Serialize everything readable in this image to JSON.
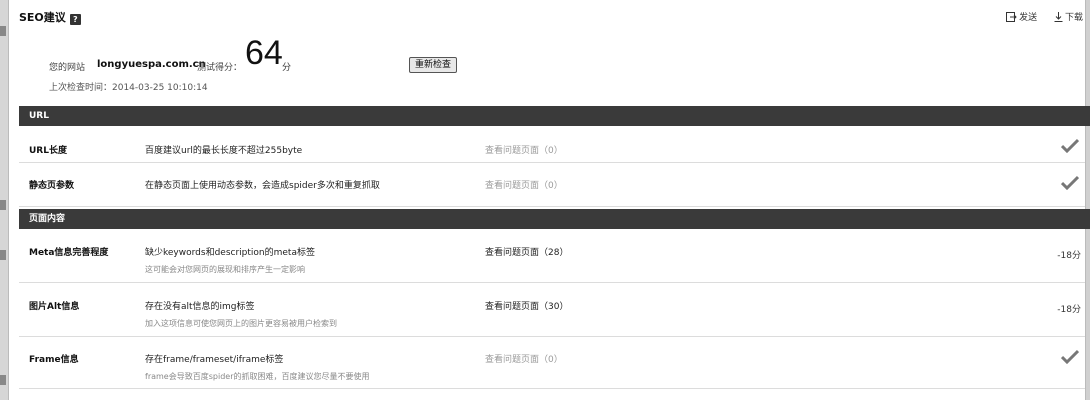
{
  "header": {
    "title": "SEO建议",
    "help_glyph": "?",
    "send_label": "发送",
    "download_label": "下载"
  },
  "summary": {
    "site_label": "您的网站",
    "site_value": "longyuespa.com.cn",
    "score_label": "测试得分：",
    "score_value": "64",
    "score_unit": "分",
    "recheck_label": "重新检查",
    "last_check": "上次检查时间：2014-03-25 10:10:14"
  },
  "sections": [
    {
      "title": "URL"
    },
    {
      "title": "页面内容"
    }
  ],
  "url_rows": [
    {
      "name": "URL长度",
      "desc": "百度建议url的最长长度不超过255byte",
      "link": "查看问题页面（0）",
      "status": "pass"
    },
    {
      "name": "静态页参数",
      "desc": "在静态页面上使用动态参数，会造成spider多次和重复抓取",
      "link": "查看问题页面（0）",
      "status": "pass"
    }
  ],
  "content_rows": [
    {
      "name": "Meta信息完善程度",
      "desc": "缺少keywords和description的meta标签",
      "note": "这可能会对您网页的展现和排序产生一定影响",
      "link": "查看问题页面（28）",
      "result": "-18分"
    },
    {
      "name": "图片Alt信息",
      "desc": "存在没有alt信息的img标签",
      "note": "加入这项信息可使您网页上的图片更容易被用户检索到",
      "link": "查看问题页面（30）",
      "result": "-18分"
    },
    {
      "name": "Frame信息",
      "desc": "存在frame/frameset/iframe标签",
      "note": "frame会导致百度spider的抓取困难，百度建议您尽量不要使用",
      "link": "查看问题页面（0）",
      "status": "pass"
    }
  ],
  "icons": {
    "help": "help-icon",
    "send": "send-icon",
    "download": "download-icon",
    "check": "check-icon"
  },
  "colors": {
    "section_bg": "#3a3a3a",
    "summary_bg": "#f0f0f0",
    "muted_link": "#9a9a9a"
  }
}
